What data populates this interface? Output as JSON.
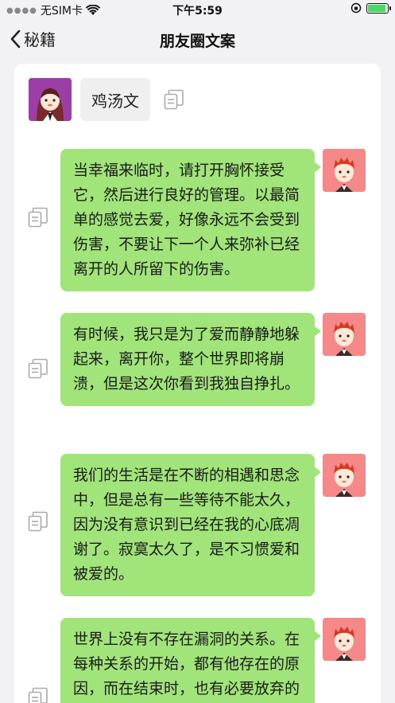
{
  "status_bar": {
    "carrier": "无SIM卡",
    "time": "下午5:59",
    "battery_fill": 0.9
  },
  "nav": {
    "back_label": "秘籍",
    "title": "朋友圈文案"
  },
  "category": {
    "label": "鸡汤文"
  },
  "messages": [
    {
      "text": "当幸福来临时，请打开胸怀接受它，然后进行良好的管理。以最简单的感觉去爱，好像永远不会受到伤害，不要让下一个人来弥补已经离开的人所留下的伤害。"
    },
    {
      "text": "有时候，我只是为了爱而静静地躲起来，离开你，整个世界即将崩溃，但是这次你看到我独自挣扎。"
    },
    {
      "text": "我们的生活是在不断的相遇和思念中，但是总有一些等待不能太久，因为没有意识到已经在我的心底凋谢了。寂寞太久了，是不习惯爱和被爱的。"
    },
    {
      "text": "世界上没有不存在漏洞的关系。在每种关系的开始，都有他存在的原因，而在结束时，也有必要放弃的原因。"
    }
  ],
  "colors": {
    "bubble": "#a0e47a",
    "header_avatar_bg": "#9b3fa6",
    "msg_avatar_bg": "#f5898a",
    "page_bg": "#f2f2f4"
  }
}
